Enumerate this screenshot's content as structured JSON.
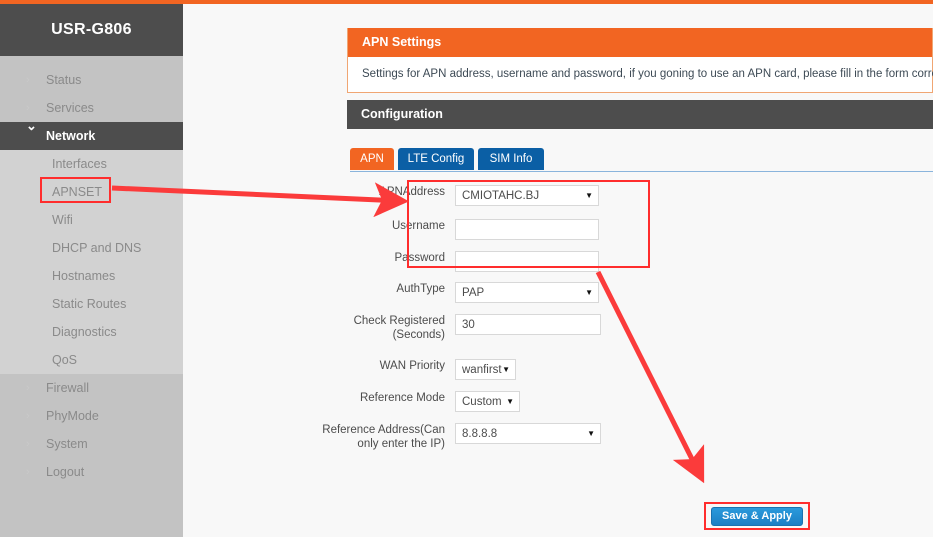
{
  "theme": {
    "accent_orange": "#f26522",
    "tab_blue": "#0b5fa5",
    "sidebar_bg": "#c3c3c3",
    "sidebar_dark": "#4d4d4d",
    "annotation_red": "#ff2d2d",
    "button_blue": "#1c7fc4"
  },
  "sidebar": {
    "brand": "USR-G806",
    "items": [
      {
        "label": "Status",
        "icon": "chevron-right-icon",
        "level": "top",
        "state": "collapsed"
      },
      {
        "label": "Services",
        "icon": "chevron-right-icon",
        "level": "top",
        "state": "collapsed"
      },
      {
        "label": "Network",
        "icon": "chevron-down-icon",
        "level": "top",
        "state": "expanded"
      },
      {
        "label": "Interfaces",
        "icon": "",
        "level": "sub",
        "state": ""
      },
      {
        "label": "APNSET",
        "icon": "",
        "level": "sub",
        "state": "highlighted"
      },
      {
        "label": "Wifi",
        "icon": "",
        "level": "sub",
        "state": ""
      },
      {
        "label": "DHCP and DNS",
        "icon": "",
        "level": "sub",
        "state": ""
      },
      {
        "label": "Hostnames",
        "icon": "",
        "level": "sub",
        "state": ""
      },
      {
        "label": "Static Routes",
        "icon": "",
        "level": "sub",
        "state": ""
      },
      {
        "label": "Diagnostics",
        "icon": "",
        "level": "sub",
        "state": ""
      },
      {
        "label": "QoS",
        "icon": "",
        "level": "sub",
        "state": ""
      },
      {
        "label": "Firewall",
        "icon": "chevron-right-icon",
        "level": "top",
        "state": "collapsed"
      },
      {
        "label": "PhyMode",
        "icon": "chevron-right-icon",
        "level": "top",
        "state": "collapsed"
      },
      {
        "label": "System",
        "icon": "chevron-right-icon",
        "level": "top",
        "state": "collapsed"
      },
      {
        "label": "Logout",
        "icon": "chevron-right-icon",
        "level": "top",
        "state": "collapsed"
      }
    ]
  },
  "apn_panel": {
    "title": "APN Settings",
    "description": "Settings for APN address, username and password, if you goning to use an APN card, please fill in the form correctly"
  },
  "configuration": {
    "title": "Configuration"
  },
  "tabs": [
    {
      "label": "APN",
      "active": true
    },
    {
      "label": "LTE Config",
      "active": false
    },
    {
      "label": "SIM Info",
      "active": false
    }
  ],
  "form": {
    "apn_address": {
      "label": "APNAddress",
      "value": "CMIOTAHC.BJ",
      "type": "select"
    },
    "username": {
      "label": "Username",
      "value": "",
      "placeholder": "",
      "type": "text"
    },
    "password": {
      "label": "Password",
      "value": "",
      "placeholder": "",
      "type": "text"
    },
    "auth_type": {
      "label": "AuthType",
      "value": "PAP",
      "type": "select"
    },
    "check_registered": {
      "label_line1": "Check Registered",
      "label_line2": "(Seconds)",
      "value": "30",
      "type": "text"
    },
    "wan_priority": {
      "label": "WAN Priority",
      "value": "wanfirst",
      "type": "select"
    },
    "reference_mode": {
      "label": "Reference Mode",
      "value": "Custom",
      "type": "select"
    },
    "reference_address": {
      "label_line1": "Reference Address(Can",
      "label_line2": "only enter the IP)",
      "value": "8.8.8.8",
      "type": "select"
    }
  },
  "actions": {
    "save_label": "Save & Apply"
  }
}
